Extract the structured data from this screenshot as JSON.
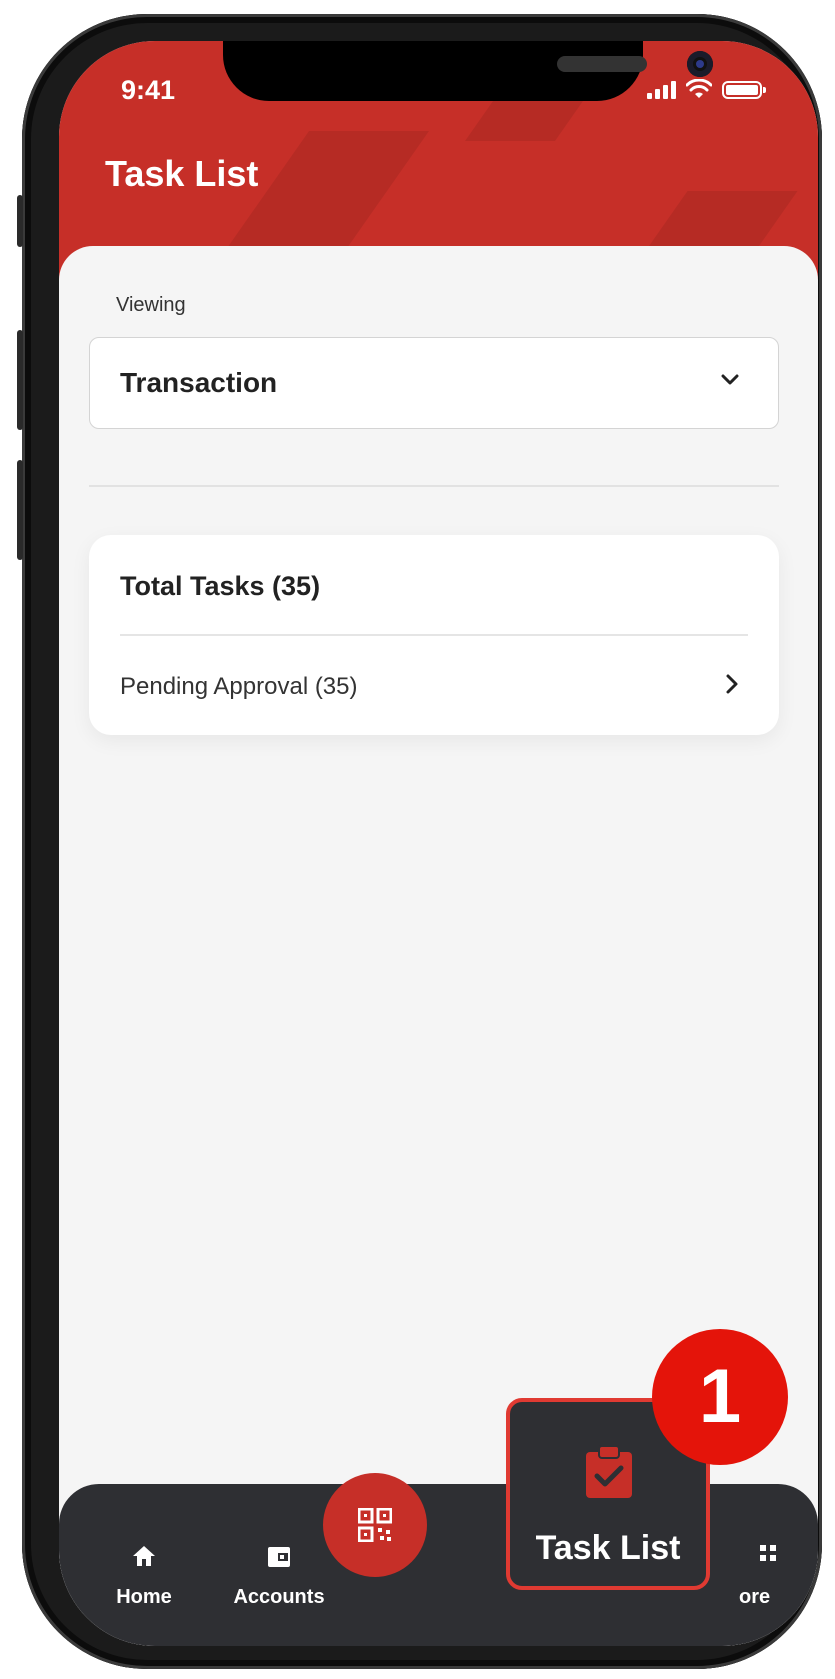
{
  "status_bar": {
    "time": "9:41"
  },
  "header": {
    "title": "Task List"
  },
  "viewing": {
    "label": "Viewing",
    "selected": "Transaction"
  },
  "tasks_card": {
    "title": "Total Tasks (35)",
    "rows": [
      {
        "label": "Pending Approval (35)"
      }
    ]
  },
  "bottom_nav": {
    "items": [
      {
        "label": "Home",
        "icon": "home-icon"
      },
      {
        "label": "Accounts",
        "icon": "wallet-icon"
      },
      {
        "label": "",
        "icon": "qr-code-icon"
      },
      {
        "label": "Task List",
        "icon": "clipboard-check-icon"
      },
      {
        "label": "ore",
        "icon": "grid-icon"
      }
    ]
  },
  "annotation": {
    "badge_number": "1"
  },
  "colors": {
    "brand_red": "#c62f28",
    "nav_bg": "#2e2f33",
    "annotation_red": "#e4140a"
  }
}
